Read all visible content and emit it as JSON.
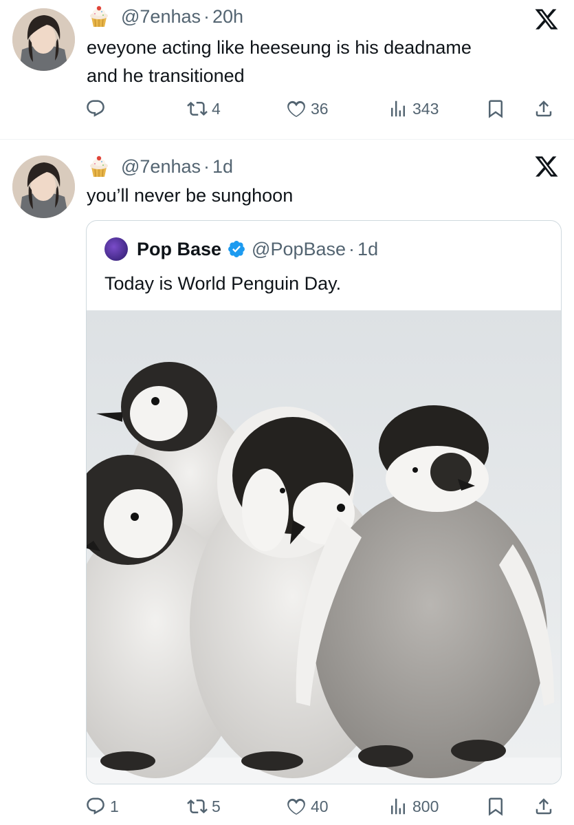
{
  "tweets": [
    {
      "handle": "@7enhas",
      "separator": "·",
      "time": "20h",
      "text_line1": "eveyone acting like heeseung is his deadname",
      "text_line2": "and he transitioned",
      "reply_count": "",
      "retweet_count": "4",
      "like_count": "36",
      "view_count": "343",
      "icons": [
        "cupcake-icon",
        "x-logo-icon",
        "reply-icon",
        "retweet-icon",
        "like-icon",
        "views-icon",
        "bookmark-icon",
        "share-icon"
      ]
    },
    {
      "handle": "@7enhas",
      "separator": "·",
      "time": "1d",
      "text_line1": "you’ll never be sunghoon",
      "reply_count": "1",
      "retweet_count": "5",
      "like_count": "40",
      "view_count": "800",
      "quote": {
        "name": "Pop Base",
        "handle": "@PopBase",
        "separator": "·",
        "time": "1d",
        "text": "Today is World Penguin Day.",
        "media": "photo of five emperor penguin chicks huddled together"
      }
    }
  ],
  "colors": {
    "text_primary": "#0f1419",
    "text_secondary": "#536471",
    "border": "#cfd9de",
    "verified_blue": "#1d9bf0"
  }
}
